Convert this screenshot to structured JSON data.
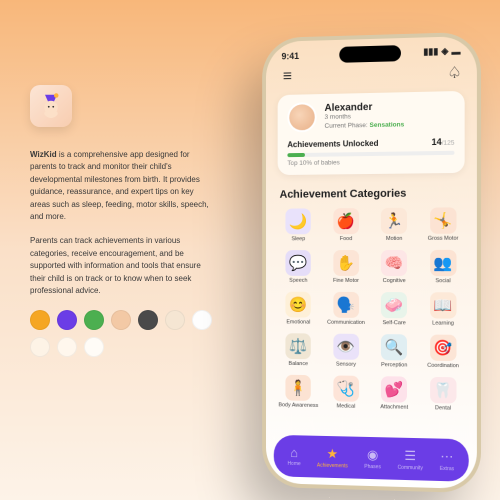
{
  "app": {
    "name": "WizKid",
    "desc1_prefix": "WizKid",
    "desc1_rest": " is a comprehensive app designed for parents to track and monitor their child's developmental milestones from birth. It provides guidance, reassurance, and expert tips on key areas such as sleep, feeding, motor skills, speech, and more.",
    "desc2": "Parents can track achievements in various categories, receive encouragement, and be supported with information and tools that ensure their child is on track or to know when to seek professional advice."
  },
  "palette": [
    "#f5a623",
    "#6b3de6",
    "#4caf50",
    "#f3c9a5",
    "#4a4a4a",
    "#f5e6d3",
    "#ffffff",
    "#fdf3e6",
    "#fff7ed",
    "#fffcf7"
  ],
  "status": {
    "time": "9:41"
  },
  "profile": {
    "name": "Alexander",
    "age": "3 months",
    "phase_label": "Current Phase:",
    "phase": "Sensations",
    "ach_title": "Achievements Unlocked",
    "count": "14",
    "total": "/125",
    "toppct": "Top 10% of babies"
  },
  "section_title": "Achievement Categories",
  "categories": [
    {
      "label": "Sleep",
      "glyph": "🌙",
      "bg": "#e9e2fb"
    },
    {
      "label": "Food",
      "glyph": "🍎",
      "bg": "#fde4d6"
    },
    {
      "label": "Motion",
      "glyph": "🏃",
      "bg": "#fce8d8"
    },
    {
      "label": "Gross Motor",
      "glyph": "🤸",
      "bg": "#fce3d3"
    },
    {
      "label": "Speech",
      "glyph": "💬",
      "bg": "#e5ddf8"
    },
    {
      "label": "Fine Motor",
      "glyph": "✋",
      "bg": "#fce5d6"
    },
    {
      "label": "Cognitive",
      "glyph": "🧠",
      "bg": "#fde6e6"
    },
    {
      "label": "Social",
      "glyph": "👥",
      "bg": "#fce3d3"
    },
    {
      "label": "Emotional",
      "glyph": "😊",
      "bg": "#fef0d8"
    },
    {
      "label": "Communication",
      "glyph": "🗣️",
      "bg": "#fce5d6"
    },
    {
      "label": "Self-Care",
      "glyph": "🧼",
      "bg": "#e8f4ea"
    },
    {
      "label": "Learning",
      "glyph": "📖",
      "bg": "#fde9d8"
    },
    {
      "label": "Balance",
      "glyph": "⚖️",
      "bg": "#f0e6d4"
    },
    {
      "label": "Sensory",
      "glyph": "👁️",
      "bg": "#eae2f9"
    },
    {
      "label": "Perception",
      "glyph": "🔍",
      "bg": "#e0eef2"
    },
    {
      "label": "Coordination",
      "glyph": "🎯",
      "bg": "#fce5d6"
    },
    {
      "label": "Body Awareness",
      "glyph": "🧍",
      "bg": "#fce3d3"
    },
    {
      "label": "Medical",
      "glyph": "🩺",
      "bg": "#fde4d8"
    },
    {
      "label": "Attachment",
      "glyph": "💕",
      "bg": "#fde2ea"
    },
    {
      "label": "Dental",
      "glyph": "🦷",
      "bg": "#fce8ea"
    }
  ],
  "tabs": [
    {
      "label": "Home",
      "glyph": "⌂"
    },
    {
      "label": "Achievements",
      "glyph": "★"
    },
    {
      "label": "Phases",
      "glyph": "◉"
    },
    {
      "label": "Community",
      "glyph": "☰"
    },
    {
      "label": "Extras",
      "glyph": "⋯"
    }
  ],
  "active_tab": 1
}
